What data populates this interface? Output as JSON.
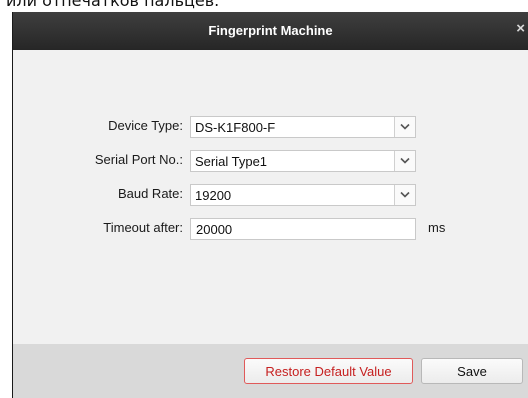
{
  "background_text": "или отпечатков пальцев.",
  "dialog": {
    "title": "Fingerprint Machine",
    "close_glyph": "×"
  },
  "form": {
    "device_type": {
      "label": "Device Type:",
      "value": "DS-K1F800-F"
    },
    "serial_port": {
      "label": "Serial Port No.:",
      "value": "Serial Type1"
    },
    "baud_rate": {
      "label": "Baud Rate:",
      "value": "19200"
    },
    "timeout": {
      "label": "Timeout after:",
      "value": "20000",
      "unit": "ms"
    }
  },
  "buttons": {
    "restore_label": "Restore Default Value",
    "save_label": "Save"
  },
  "colors": {
    "titlebar": "#2f2f2f",
    "restore_accent": "#c62020",
    "footer": "#d9d9d9"
  }
}
